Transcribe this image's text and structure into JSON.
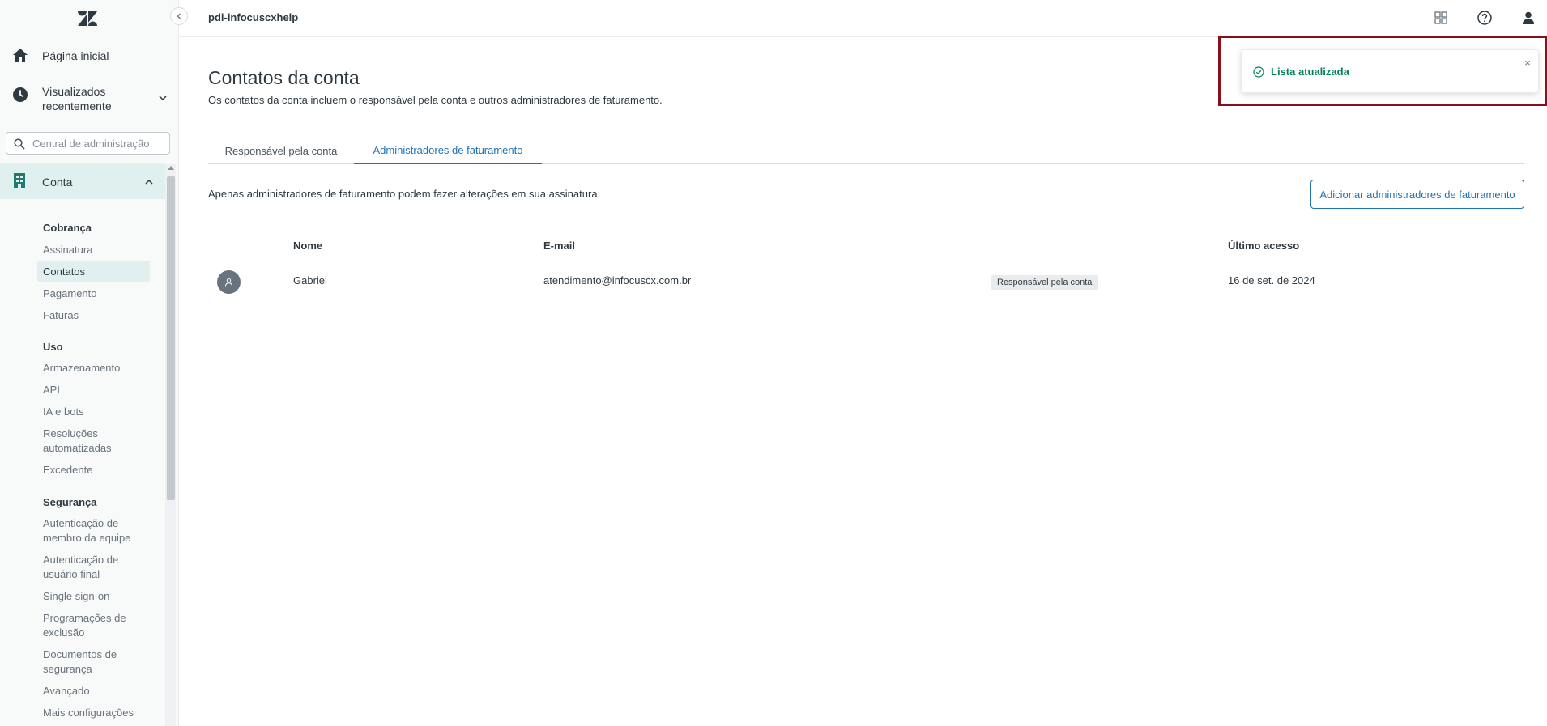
{
  "colors": {
    "accent": "#1f73b7",
    "success": "#038153",
    "selected_bg": "#dff0ee",
    "highlight_frame": "#8b0e1a"
  },
  "topbar": {
    "account_name": "pdi-infocuscxhelp",
    "icons": [
      "products-grid-icon",
      "help-icon",
      "user-profile-icon"
    ]
  },
  "sidebar": {
    "home_label": "Página inicial",
    "recent_label_line1": "Visualizados",
    "recent_label_line2": "recentemente",
    "search_placeholder": "Central de administração",
    "conta_label": "Conta",
    "sections": {
      "billing": {
        "title": "Cobrança",
        "items": [
          "Assinatura",
          "Contatos",
          "Pagamento",
          "Faturas"
        ],
        "active": "Contatos"
      },
      "usage": {
        "title": "Uso",
        "items": [
          "Armazenamento",
          "API",
          "IA e bots",
          "Resoluções automatizadas",
          "Excedente"
        ]
      },
      "security": {
        "title": "Segurança",
        "items": [
          "Autenticação de membro da equipe",
          "Autenticação de usuário final",
          "Single sign-on",
          "Programações de exclusão",
          "Documentos de segurança",
          "Avançado",
          "Mais configurações"
        ]
      }
    }
  },
  "main": {
    "title": "Contatos da conta",
    "subtitle": "Os contatos da conta incluem o responsável pela conta e outros administradores de faturamento.",
    "tabs": [
      {
        "label": "Responsável pela conta",
        "selected": false
      },
      {
        "label": "Administradores de faturamento",
        "selected": true
      }
    ],
    "notice": "Apenas administradores de faturamento podem fazer alterações em sua assinatura.",
    "add_button": "Adicionar administradores de faturamento",
    "table": {
      "headers": [
        "Nome",
        "E-mail",
        "Último acesso"
      ],
      "rows": [
        {
          "name": "Gabriel",
          "email": "atendimento@infocuscx.com.br",
          "badge": "Responsável pela conta",
          "last_access": "16 de set. de 2024"
        }
      ]
    }
  },
  "toast": {
    "message": "Lista atualizada",
    "close_glyph": "×"
  }
}
